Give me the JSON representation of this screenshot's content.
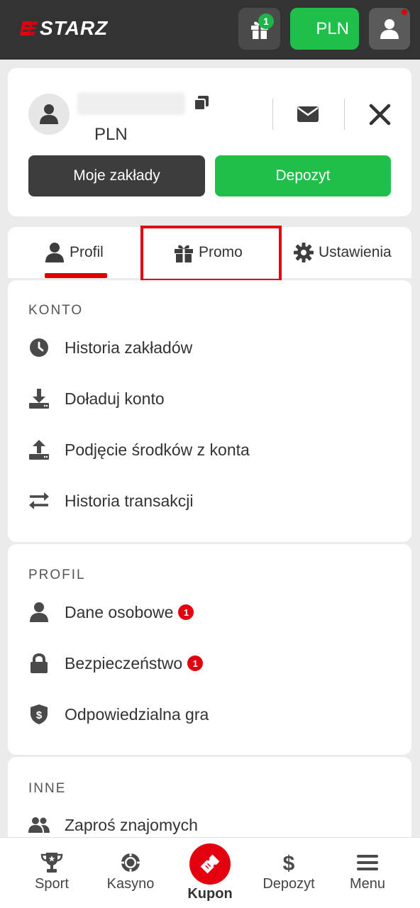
{
  "header": {
    "logo_text": "STARZ",
    "gift_badge_count": "1",
    "currency_button": "PLN"
  },
  "account": {
    "currency": "PLN",
    "my_bets_button": "Moje zakłady",
    "deposit_button": "Depozyt"
  },
  "tabs": [
    {
      "label": "Profil",
      "icon": "person-icon",
      "active": true
    },
    {
      "label": "Promo",
      "icon": "gift-icon",
      "active": false
    },
    {
      "label": "Ustawienia",
      "icon": "gear-icon",
      "active": false
    }
  ],
  "sections": {
    "konto": {
      "title": "KONTO",
      "items": [
        {
          "label": "Historia zakładów",
          "icon": "clock-icon"
        },
        {
          "label": "Doładuj konto",
          "icon": "download-icon"
        },
        {
          "label": "Podjęcie środków z konta",
          "icon": "upload-icon"
        },
        {
          "label": "Historia transakcji",
          "icon": "exchange-arrows-icon"
        }
      ]
    },
    "profil": {
      "title": "PROFIL",
      "items": [
        {
          "label": "Dane osobowe",
          "icon": "person-icon",
          "badge": "1"
        },
        {
          "label": "Bezpieczeństwo",
          "icon": "lock-icon",
          "badge": "1"
        },
        {
          "label": "Odpowiedzialna gra",
          "icon": "shield-dollar-icon"
        }
      ]
    },
    "inne": {
      "title": "INNE",
      "items": [
        {
          "label": "Zaproś znajomych",
          "icon": "users-icon"
        }
      ]
    }
  },
  "bottom_nav": [
    {
      "label": "Sport",
      "icon": "trophy-icon"
    },
    {
      "label": "Kasyno",
      "icon": "casino-chip-icon"
    },
    {
      "label": "Kupon",
      "icon": "ticket-icon",
      "active": true
    },
    {
      "label": "Depozyt",
      "icon": "dollar-icon"
    },
    {
      "label": "Menu",
      "icon": "hamburger-icon"
    }
  ],
  "colors": {
    "header_bg": "#333333",
    "accent_green": "#1fbf4a",
    "accent_red": "#e3000f",
    "page_bg": "#ebebeb"
  }
}
